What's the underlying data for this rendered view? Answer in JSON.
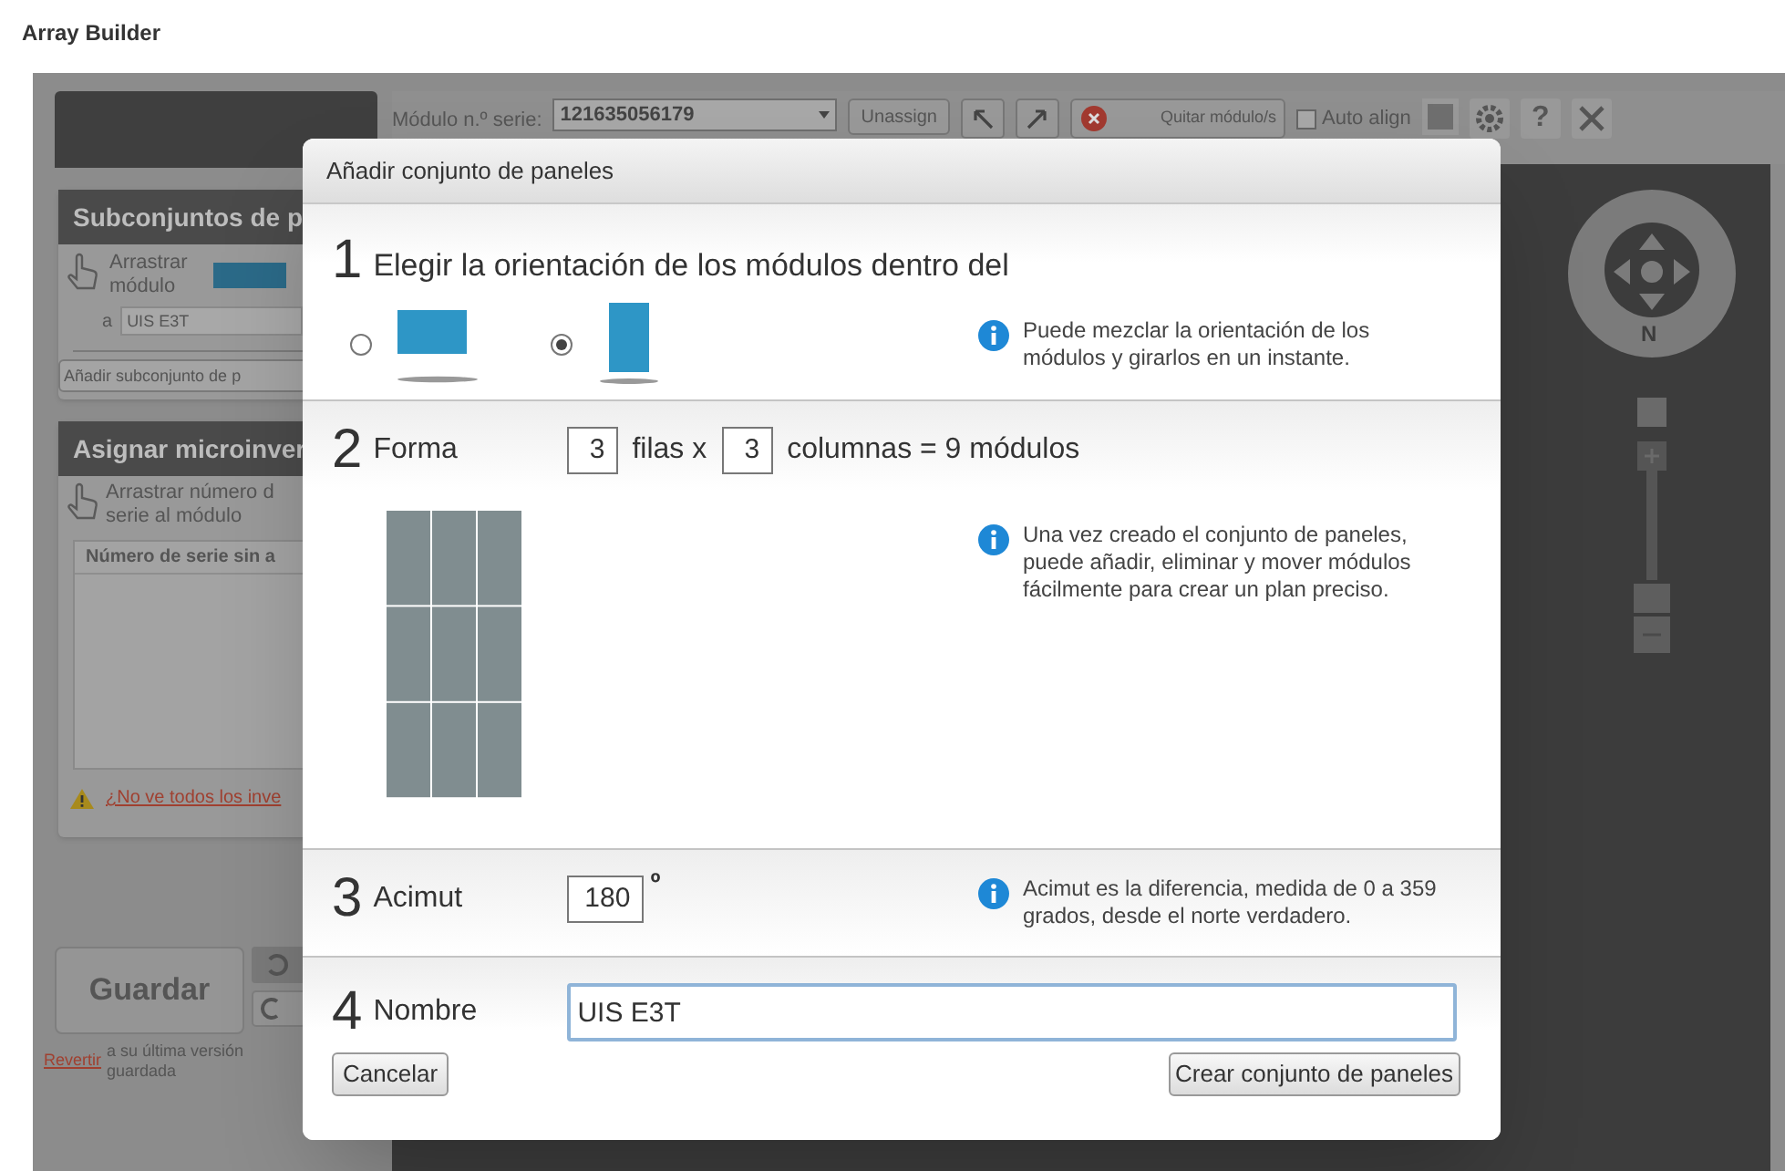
{
  "app_title": "Array Builder",
  "toolbar": {
    "serial_label": "Módulo n.º serie:",
    "serial_value": "121635056179",
    "unassign": "Unassign",
    "remove": "Quitar módulo/s",
    "auto_align": {
      "label": "Auto align",
      "checked": false
    },
    "help": "?"
  },
  "subsets": {
    "title": "Subconjuntos de p",
    "drag_label": [
      "Arrastrar",
      "módulo"
    ],
    "to_label": "a",
    "target": "UIS E3T",
    "add_button": "Añadir subconjunto de p"
  },
  "microinverters": {
    "title": "Asignar microinver",
    "hint": [
      "Arrastrar número d",
      "serie al módulo"
    ],
    "list_header": "Número de serie sin a",
    "warning_link": "¿No ve todos los inve"
  },
  "save": {
    "button": "Guardar",
    "revert_link": "Revertir",
    "revert_text": [
      "a su última versión",
      "guardada"
    ]
  },
  "compass": {
    "north": "N"
  },
  "dialog": {
    "title": "Añadir conjunto de paneles",
    "steps": [
      {
        "kind": "orientation",
        "number": "1",
        "heading": "Elegir la orientación de los módulos dentro del",
        "options": [
          {
            "kind": "landscape",
            "selected": false
          },
          {
            "kind": "portrait",
            "selected": true
          }
        ],
        "info": "Puede mezclar la orientación de los módulos y girarlos en un instante."
      },
      {
        "kind": "shape",
        "number": "2",
        "label": "Forma",
        "rows": "3",
        "rows_label": "filas x",
        "columns": "3",
        "columns_label": "columnas = 9 módulos",
        "info": "Una vez creado el conjunto de paneles, puede añadir, eliminar y mover módulos fácilmente para crear un plan preciso."
      },
      {
        "kind": "azimuth",
        "number": "3",
        "label": "Acimut",
        "value": "180",
        "unit": "º",
        "info": "Acimut es la diferencia, medida de 0 a 359 grados, desde el norte verdadero."
      },
      {
        "kind": "name",
        "number": "4",
        "label": "Nombre",
        "value": "UIS E3T"
      }
    ],
    "buttons": {
      "cancel": "Cancelar",
      "create": "Crear conjunto de paneles"
    }
  }
}
